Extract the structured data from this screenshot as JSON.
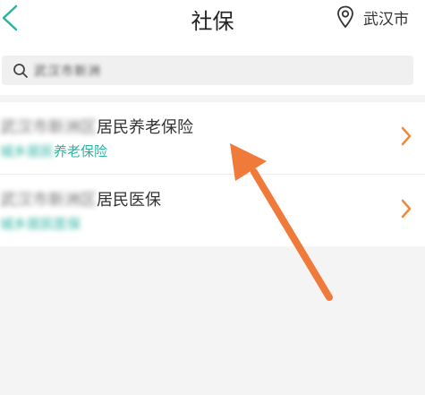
{
  "header": {
    "title": "社保",
    "city": "武汉市",
    "back_icon": "chevron-left-icon",
    "location_icon": "location-pin-icon",
    "accent_color": "#2bb3a1"
  },
  "search": {
    "value": "武汉市新洲",
    "icon": "search-icon"
  },
  "items": [
    {
      "title_blurred": "武汉市新洲区",
      "title_visible": "居民养老保险",
      "subtitle_blurred": "城乡居民",
      "subtitle_visible": "养老保险"
    },
    {
      "title_blurred": "武汉市新洲区",
      "title_visible": "居民医保",
      "subtitle_blurred": "城乡居民医保",
      "subtitle_visible": ""
    }
  ],
  "annotation": {
    "arrow_color": "#f07a3a"
  }
}
